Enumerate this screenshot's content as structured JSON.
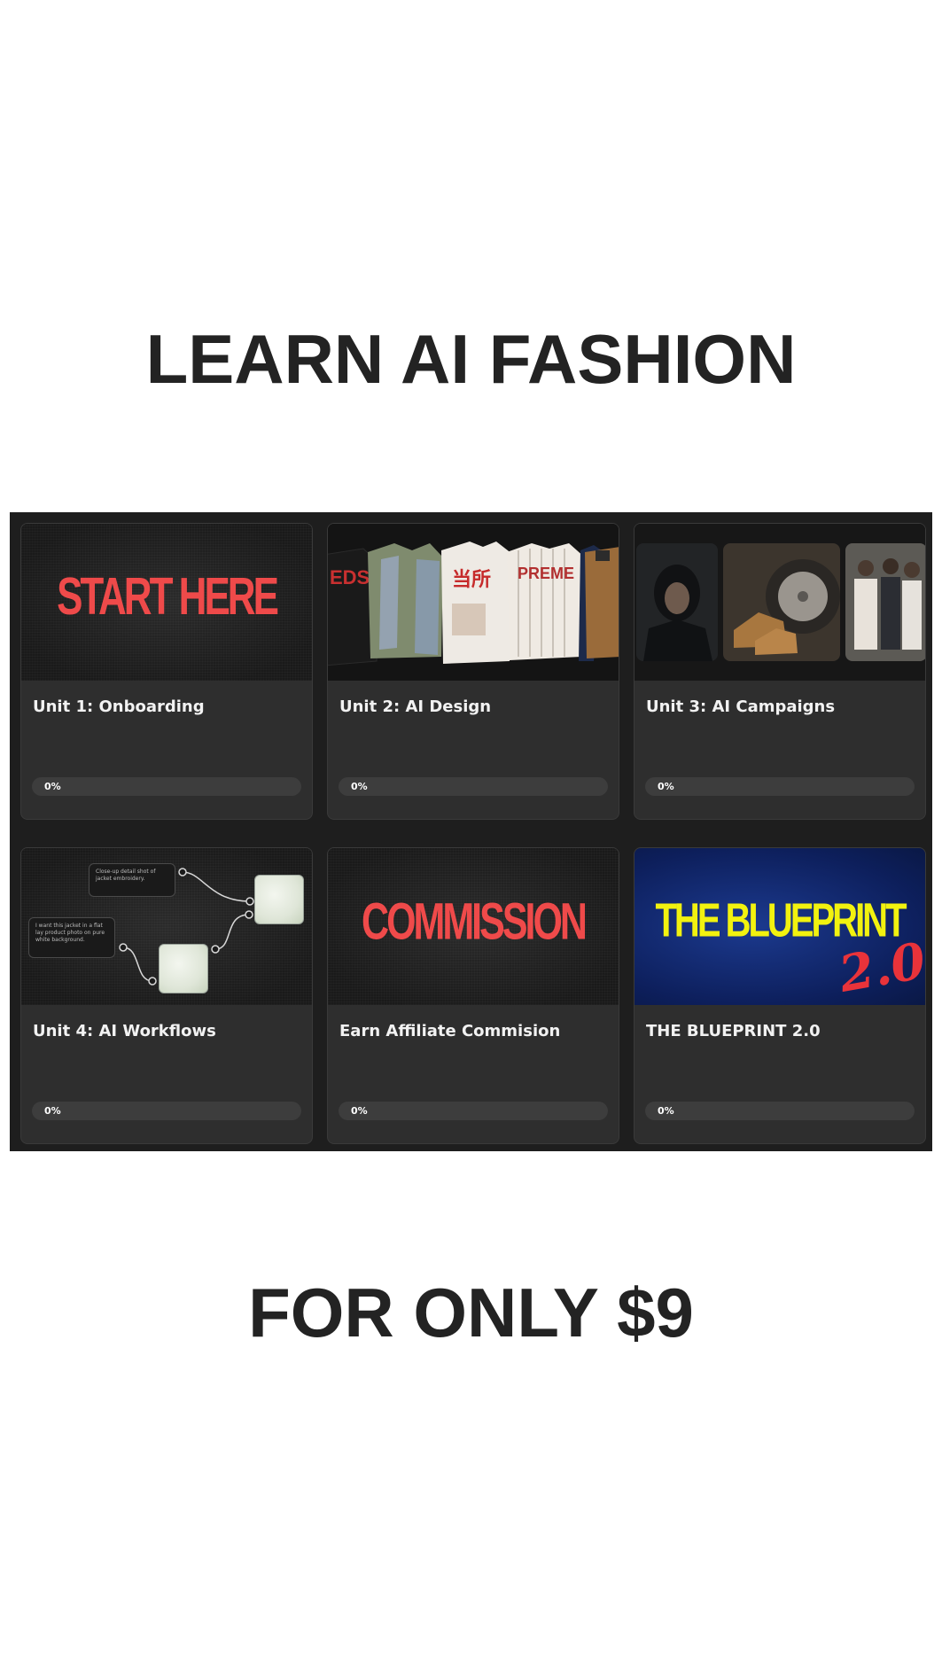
{
  "headline_top": "LEARN AI FASHION",
  "headline_bottom": "FOR ONLY $9",
  "colors": {
    "page_bg": "#ffffff",
    "panel_bg": "#1e1e1e",
    "card_bg": "#2e2e2e",
    "accent_red": "#ef4a4a",
    "blueprint_yellow": "#f2f20f",
    "blueprint_blue": "#0d1f5c"
  },
  "courses": [
    {
      "title": "Unit 1: Onboarding",
      "thumbnail_text": "START HERE",
      "thumbnail": "start-here-banner",
      "progress_label": "0%",
      "progress": 0
    },
    {
      "title": "Unit 2: AI Design",
      "thumbnail": "streetwear-jackets-photo",
      "progress_label": "0%",
      "progress": 0
    },
    {
      "title": "Unit 3: AI Campaigns",
      "thumbnail": "campaign-photos-collage",
      "progress_label": "0%",
      "progress": 0
    },
    {
      "title": "Unit 4: AI Workflows",
      "thumbnail": "workflow-node-diagram",
      "workflow_prompts": [
        "Close-up detail shot of jacket embroidery.",
        "I want this jacket in a flat lay product photo on pure white background."
      ],
      "progress_label": "0%",
      "progress": 0
    },
    {
      "title": "Earn Affiliate Commision",
      "thumbnail_text": "COMMISSION",
      "thumbnail": "commission-banner",
      "progress_label": "0%",
      "progress": 0
    },
    {
      "title": "THE BLUEPRINT 2.0",
      "thumbnail_text": "THE BLUEPRINT",
      "thumbnail_subtext": "2.0",
      "thumbnail": "blueprint-banner",
      "progress_label": "0%",
      "progress": 0
    }
  ]
}
